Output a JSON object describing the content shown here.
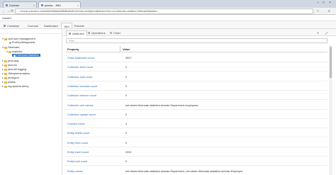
{
  "browser": {
    "tabs": [
      {
        "label": "Contact"
      },
      {
        "label": "jolokia - JMX"
      }
    ],
    "url": "chrome-extension://c4ebd5b49d8dbde8f8dfbd5ef5c1d/index.html#/jmx/attributes?nid=root-hibernate-statistics-HibernateStatistics",
    "controls": {
      "back": "←",
      "forward": "→",
      "reload": "⟳",
      "menu": "≡",
      "star": "☆"
    }
  },
  "app": {
    "title": "HawtIO"
  },
  "toolbar": {
    "tabs": [
      {
        "label": "Container"
      },
      {
        "label": "Connect"
      },
      {
        "label": "Dashboard"
      },
      {
        "label": "JMX"
      },
      {
        "label": "Threads"
      }
    ]
  },
  "tree": {
    "items": [
      {
        "label": "conf.som.management"
      },
      {
        "label": "ProtSpotDiagnostic"
      },
      {
        "label": "Hibernate"
      },
      {
        "label": "statistics"
      },
      {
        "label": "HibernateStatistics"
      },
      {
        "label": "java.lang"
      },
      {
        "label": "java.nio"
      },
      {
        "label": "java.util.logging"
      },
      {
        "label": "JMImplementation"
      },
      {
        "label": "jmxAgent"
      },
      {
        "label": "jolokia"
      },
      {
        "label": "org.apache.derby"
      }
    ]
  },
  "panel": {
    "subtabs": [
      {
        "label": "Attributes"
      },
      {
        "label": "Operations"
      },
      {
        "label": "Chart"
      }
    ],
    "filter_placeholder": "Filter...",
    "columns": {
      "property": "Property",
      "value": "Value"
    },
    "rows": [
      {
        "property": "Close statement count",
        "value": "4007"
      },
      {
        "property": "Collection fetch count",
        "value": "0"
      },
      {
        "property": "Collection load count",
        "value": "0"
      },
      {
        "property": "Collection recreate count",
        "value": "2"
      },
      {
        "property": "Collection remove count",
        "value": "0"
      },
      {
        "property": "Collection role names",
        "value": "net.eisele.hibernate.statistics.domain.Department.employees"
      },
      {
        "property": "Collection update count",
        "value": "0"
      },
      {
        "property": "Connect count",
        "value": "4"
      },
      {
        "property": "Entity delete count",
        "value": "0"
      },
      {
        "property": "Entity fetch count",
        "value": "0"
      },
      {
        "property": "Entity insert count",
        "value": "2002"
      },
      {
        "property": "Entity load count",
        "value": "0"
      },
      {
        "property": "Entity names",
        "value": "net.eisele.hibernate.statistics.domain.Department, net.eisele.hibernate.statistics.domain.Employee"
      }
    ]
  },
  "colors": {
    "link": "#2a6ebb",
    "selected": "#2f6fb5",
    "folder": "#e0b94e"
  }
}
